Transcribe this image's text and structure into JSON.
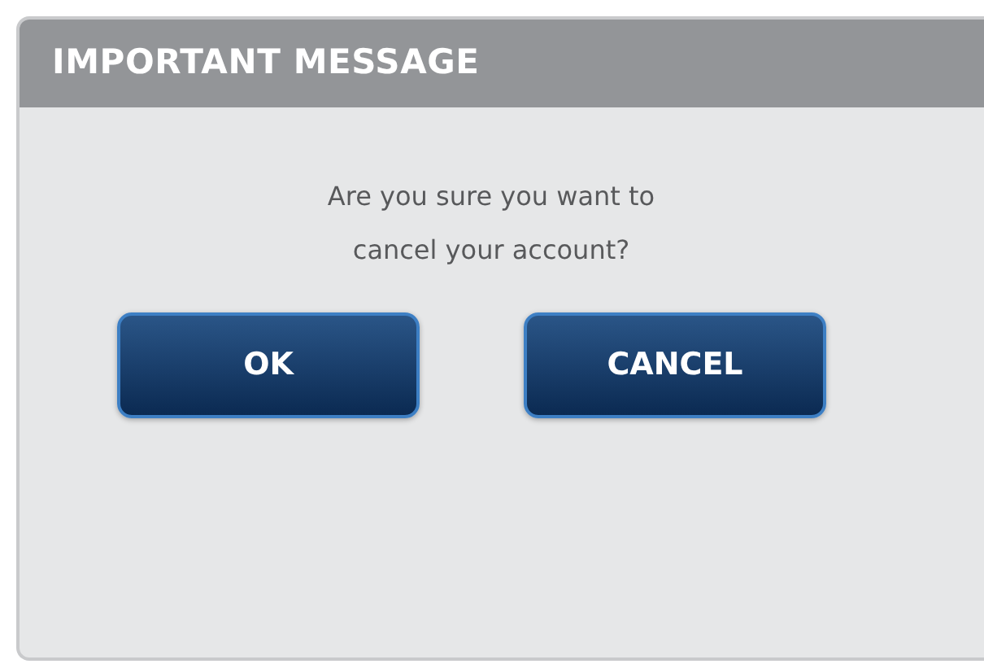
{
  "dialog": {
    "title": "IMPORTANT MESSAGE",
    "message": "Are you sure you want to cancel your account?",
    "buttons": [
      {
        "label": "OK"
      },
      {
        "label": "CANCEL"
      }
    ]
  }
}
